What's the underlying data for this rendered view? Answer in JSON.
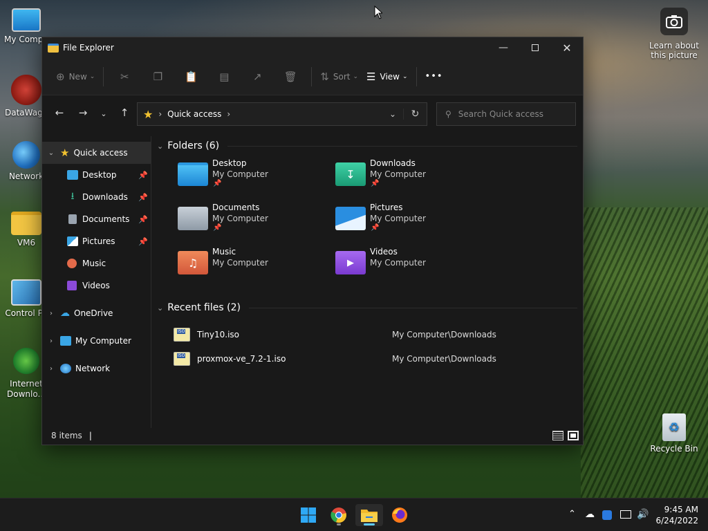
{
  "desktop": {
    "icons": [
      {
        "label": "My Compu"
      },
      {
        "label": "DataWago"
      },
      {
        "label": "Network"
      },
      {
        "label": "VM6"
      },
      {
        "label": "Control Pa"
      },
      {
        "label": "Internet"
      },
      {
        "label": "Downlo..."
      },
      {
        "label": "Recycle Bin"
      }
    ],
    "camera_label_1": "Learn about",
    "camera_label_2": "this picture"
  },
  "window": {
    "title": "File Explorer",
    "toolbar": {
      "new_label": "New",
      "sort_label": "Sort",
      "view_label": "View",
      "more_label": "•••"
    },
    "address": {
      "path": "Quick access"
    },
    "search": {
      "placeholder": "Search Quick access"
    },
    "nav": {
      "quick_access": "Quick access",
      "items": [
        {
          "label": "Desktop"
        },
        {
          "label": "Downloads"
        },
        {
          "label": "Documents"
        },
        {
          "label": "Pictures"
        },
        {
          "label": "Music"
        },
        {
          "label": "Videos"
        }
      ],
      "onedrive": "OneDrive",
      "my_computer": "My Computer",
      "network": "Network"
    },
    "folders": {
      "header": "Folders (6)",
      "items": [
        {
          "name": "Desktop",
          "location": "My Computer"
        },
        {
          "name": "Downloads",
          "location": "My Computer"
        },
        {
          "name": "Documents",
          "location": "My Computer"
        },
        {
          "name": "Pictures",
          "location": "My Computer"
        },
        {
          "name": "Music",
          "location": "My Computer"
        },
        {
          "name": "Videos",
          "location": "My Computer"
        }
      ]
    },
    "recent": {
      "header": "Recent files (2)",
      "files": [
        {
          "name": "Tiny10.iso",
          "location": "My Computer\\Downloads"
        },
        {
          "name": "proxmox-ve_7.2-1.iso",
          "location": "My Computer\\Downloads"
        }
      ]
    },
    "status": {
      "count": "8 items"
    }
  },
  "taskbar": {
    "time": "9:45 AM",
    "date": "6/24/2022"
  },
  "colors": {
    "accent": "#60cdff",
    "star": "#f2c230",
    "window_bg": "#191919"
  }
}
